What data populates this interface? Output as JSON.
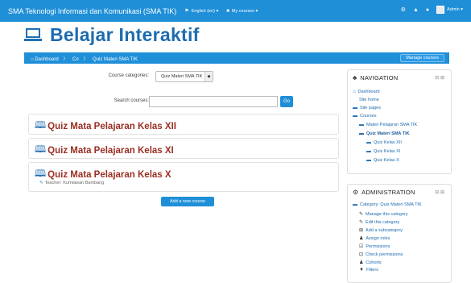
{
  "topbar": {
    "site_name": "SMA Teknologi Informasi dan Komunikasi (SMA TIK)",
    "language": "English (en) ▾",
    "my_courses": "My courses ▾",
    "user": "Admin ▾"
  },
  "header": {
    "title": "Belajar Interaktif"
  },
  "breadcrumb": {
    "items": [
      "Dashboard",
      "Co",
      "Quiz Materi SMA TIK"
    ]
  },
  "manage_courses_label": "Manage courses",
  "form": {
    "category_label": "Course categories:",
    "category_value": "Quiz Materi SMA TIK",
    "search_label": "Search courses:",
    "search_placeholder": "",
    "go_label": "Go"
  },
  "categories": [
    {
      "title": "Quiz Mata Pelajaran Kelas XII"
    },
    {
      "title": "Quiz Mata Pelajaran Kelas XI"
    },
    {
      "title": "Quiz Mata Pelajaran Kelas X",
      "teacher": "Teacher: Kurniawan Bambang"
    }
  ],
  "add_course_label": "Add a new course",
  "navigation": {
    "title": "NAVIGATION",
    "items": [
      "Dashboard",
      "Site home",
      "Site pages",
      "Courses",
      "Materi Pelajaran SMA TIK",
      "Quiz Materi SMA TIK",
      "Quiz Kelas XII",
      "Quiz Kelas XI",
      "Quiz Kelas X"
    ]
  },
  "administration": {
    "title": "ADMINISTRATION",
    "items": [
      "Category: Quiz Materi SMA TIK",
      "Manage this category",
      "Edit this category",
      "Add a subcategory",
      "Assign roles",
      "Permissions",
      "Check permissions",
      "Cohorts",
      "Filters"
    ]
  },
  "colors": {
    "brand_blue": "#1f8fd8",
    "category_title": "#9c2e22"
  },
  "icons": [
    "laptop-icon",
    "home-icon",
    "book-icon",
    "folder-icon",
    "gear-icon",
    "bell-icon",
    "chat-icon",
    "sitemap-icon"
  ]
}
